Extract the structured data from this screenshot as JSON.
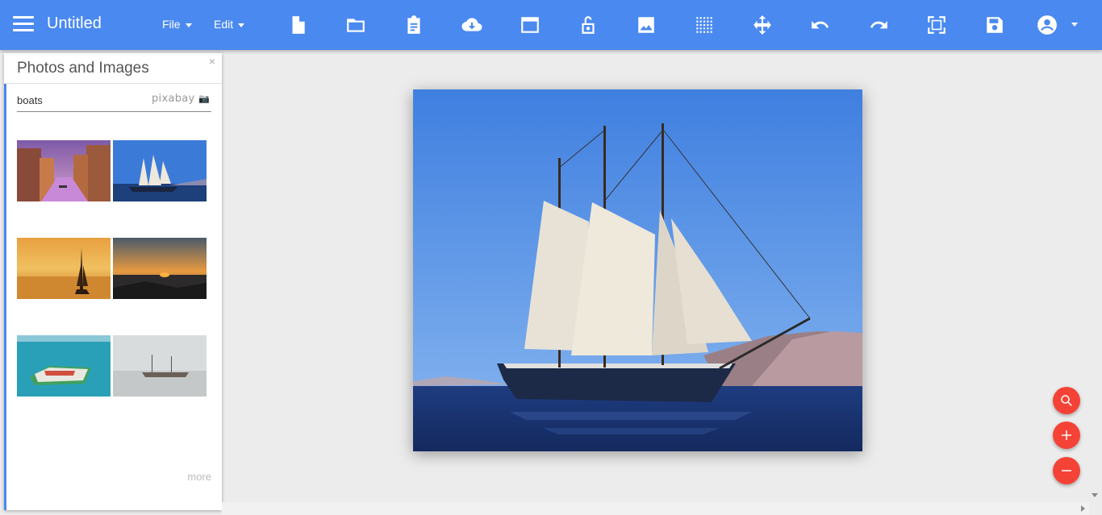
{
  "app": {
    "title": "Untitled",
    "menus": [
      "File",
      "Edit"
    ]
  },
  "toolbar": {
    "icons": [
      "new-file-icon",
      "folder-icon",
      "clipboard-icon",
      "cloud-download-icon",
      "window-icon",
      "lock-open-icon",
      "image-icon",
      "grid-icon",
      "move-icon",
      "undo-icon",
      "redo-icon",
      "fullscreen-icon",
      "save-icon",
      "account-icon"
    ]
  },
  "panel": {
    "title": "Photos and Images",
    "close": "×",
    "search_value": "boats",
    "provider": "pixabay",
    "more_label": "more"
  },
  "fabs": [
    "zoom-icon",
    "zoom-in-icon",
    "zoom-out-icon"
  ],
  "colors": {
    "topbar": "#4a89f0",
    "fab": "#f44336",
    "accent": "#4a89f0"
  }
}
